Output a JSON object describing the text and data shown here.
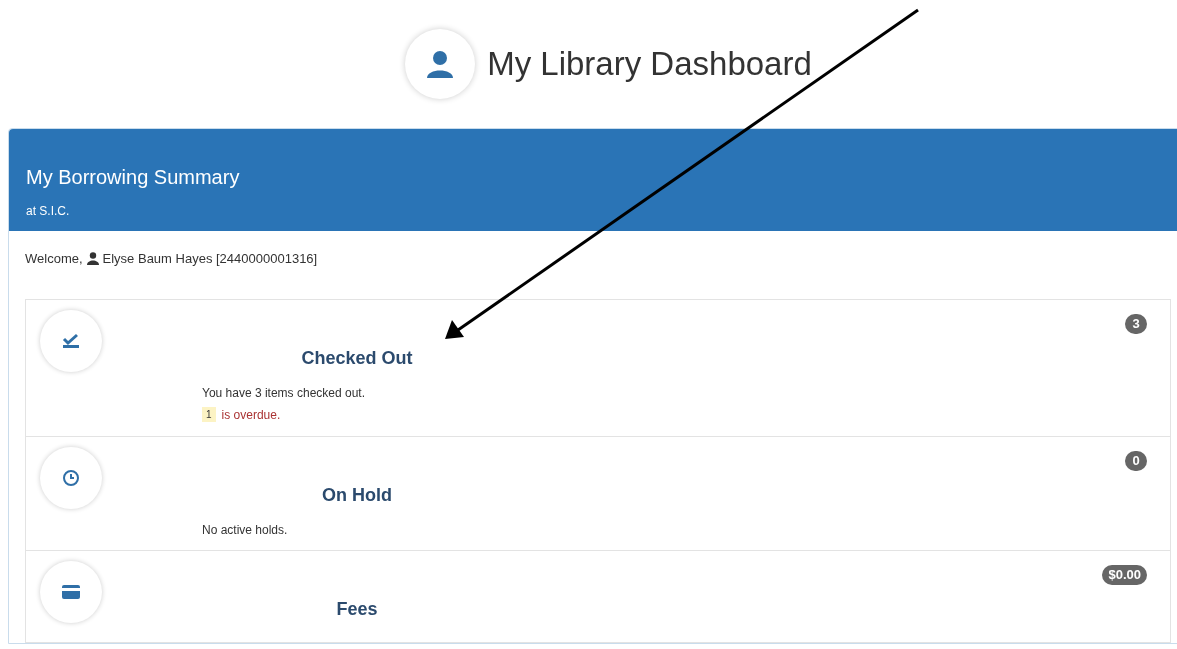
{
  "header": {
    "title": "My Library Dashboard"
  },
  "panel": {
    "title": "My Borrowing Summary",
    "subtitle": "at S.I.C.",
    "welcome": {
      "label": "Welcome,",
      "patron": "Elyse Baum Hayes [2440000001316]"
    }
  },
  "sections": [
    {
      "kind": "loans",
      "title": "Checked Out",
      "count": "3",
      "lines": [
        {
          "kind": "text",
          "text": "You have 3 items checked out."
        },
        {
          "kind": "alert",
          "count": "1",
          "text": "is overdue."
        }
      ]
    },
    {
      "kind": "holds",
      "title": "On Hold",
      "count": "0",
      "lines": [
        {
          "kind": "text",
          "text": "No active holds."
        }
      ]
    },
    {
      "kind": "fees",
      "title": "Fees",
      "count": "$0.00"
    }
  ]
}
